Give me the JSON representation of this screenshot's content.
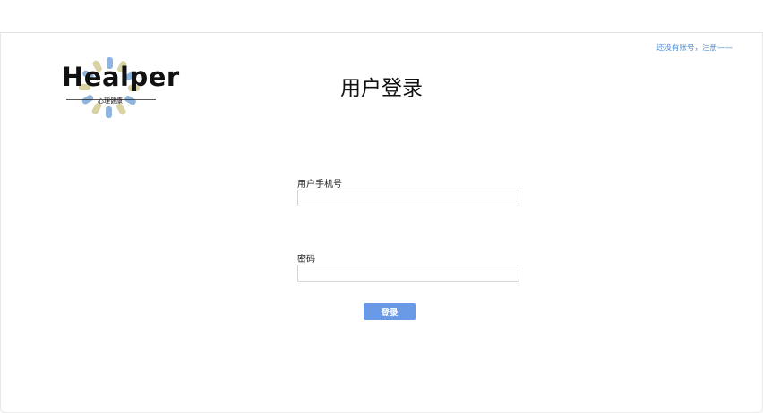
{
  "header": {
    "register_link": "还没有账号，注册——"
  },
  "logo": {
    "wordmark": "Healper",
    "subtitle": "心理健康",
    "colors": {
      "blue": "#8fb5de",
      "yellow": "#d9d2a2"
    }
  },
  "login": {
    "title": "用户登录",
    "phone_label": "用户手机号",
    "phone_value": "",
    "password_label": "密码",
    "password_value": "",
    "submit_label": "登录"
  },
  "colors": {
    "accent": "#6a9ae6",
    "link": "#4d8fd8"
  }
}
